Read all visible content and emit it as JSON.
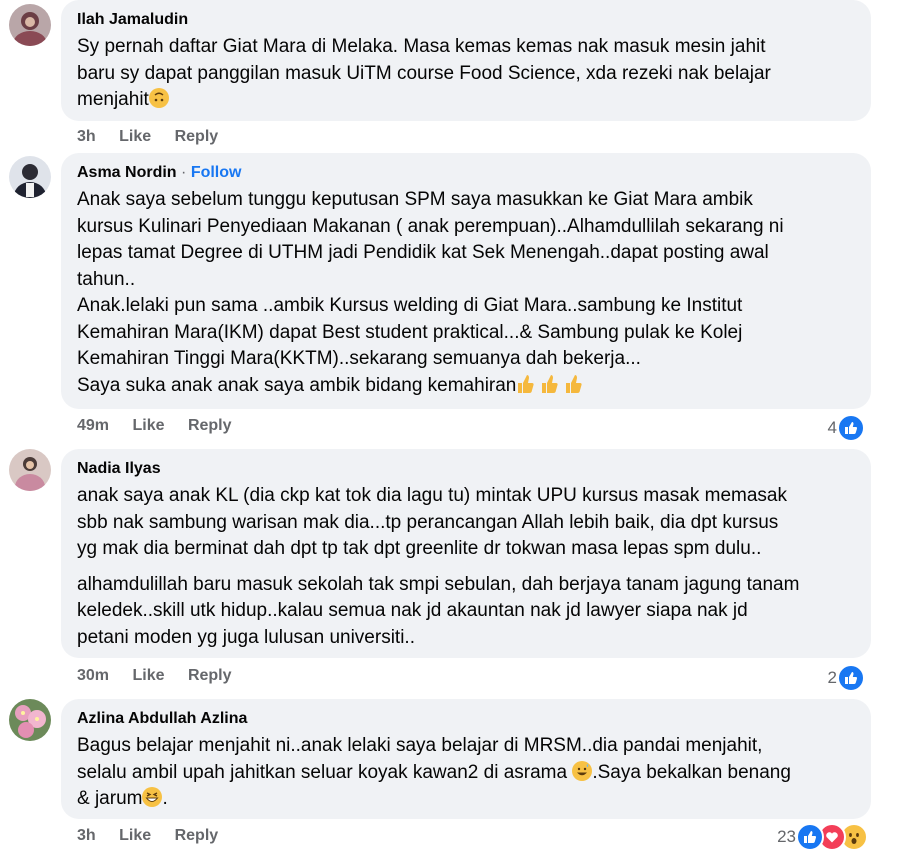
{
  "comments": [
    {
      "name": "Ilah Jamaludin",
      "lines": [
        "Sy pernah daftar Giat Mara di Melaka. Masa kemas kemas nak masuk mesin jahit",
        "baru sy dapat panggilan masuk UiTM course Food Science, xda rezeki nak belajar",
        "menjahit"
      ],
      "time": "3h",
      "like": "Like",
      "reply": "Reply"
    },
    {
      "name": "Asma Nordin",
      "follow_sep": "·",
      "follow": "Follow",
      "lines": [
        "Anak saya sebelum tunggu keputusan SPM saya masukkan ke Giat Mara ambik",
        "kursus Kulinari Penyediaan Makanan ( anak perempuan)..Alhamdullilah sekarang ni",
        "lepas tamat Degree di UTHM jadi Pendidik kat Sek Menengah..dapat posting awal",
        "tahun..",
        "Anak.lelaki pun sama ..ambik Kursus welding di Giat Mara..sambung ke Institut",
        "Kemahiran Mara(IKM) dapat Best student praktical...& Sambung pulak ke Kolej",
        "Kemahiran Tinggi Mara(KKTM)..sekarang semuanya dah bekerja...",
        "Saya suka anak anak saya ambik bidang kemahiran"
      ],
      "time": "49m",
      "like": "Like",
      "reply": "Reply",
      "reaction_count": "4"
    },
    {
      "name": "Nadia Ilyas",
      "lines": [
        "anak saya anak KL (dia ckp kat tok dia lagu tu) mintak UPU kursus masak memasak",
        "sbb nak sambung warisan mak dia...tp perancangan Allah lebih baik, dia dpt kursus",
        "yg mak dia berminat dah dpt tp tak dpt greenlite dr tokwan masa lepas spm dulu.."
      ],
      "lines2": [
        "alhamdulillah baru masuk sekolah tak smpi sebulan, dah berjaya tanam jagung tanam",
        "keledek..skill utk hidup..kalau semua nak jd akauntan nak jd lawyer siapa nak jd",
        "petani moden yg juga lulusan universiti.."
      ],
      "time": "30m",
      "like": "Like",
      "reply": "Reply",
      "reaction_count": "2"
    },
    {
      "name": "Azlina Abdullah Azlina",
      "lines": [
        "Bagus belajar menjahit ni..anak lelaki saya belajar di MRSM..dia pandai menjahit,",
        "selalu ambil upah jahitkan seluar koyak kawan2 di asrama",
        "& jarum"
      ],
      "line2_tail": ".Saya bekalkan benang",
      "line3_tail": ".",
      "time": "3h",
      "like": "Like",
      "reply": "Reply",
      "reaction_count": "23"
    }
  ]
}
